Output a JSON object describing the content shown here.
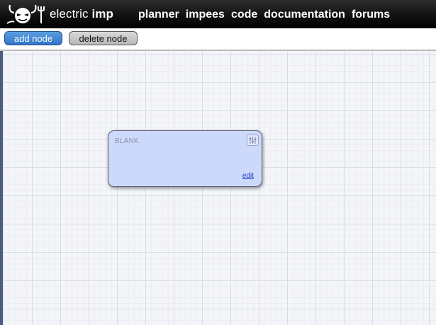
{
  "header": {
    "brand_light": "electric",
    "brand_bold": "imp",
    "logo_icon": "imp-devil-logo-icon",
    "nav": [
      {
        "label": "planner"
      },
      {
        "label": "impees"
      },
      {
        "label": "code"
      },
      {
        "label": "documentation"
      },
      {
        "label": "forums"
      }
    ]
  },
  "toolbar": {
    "add_label": "add node",
    "delete_label": "delete node"
  },
  "node": {
    "title": "BLANK",
    "edit_label": "edit",
    "settings_icon": "sliders-icon"
  },
  "colors": {
    "header_bg": "#111111",
    "add_button": "#3a80d0",
    "node_bg": "#cdd9fb",
    "link": "#1f3fbf"
  }
}
